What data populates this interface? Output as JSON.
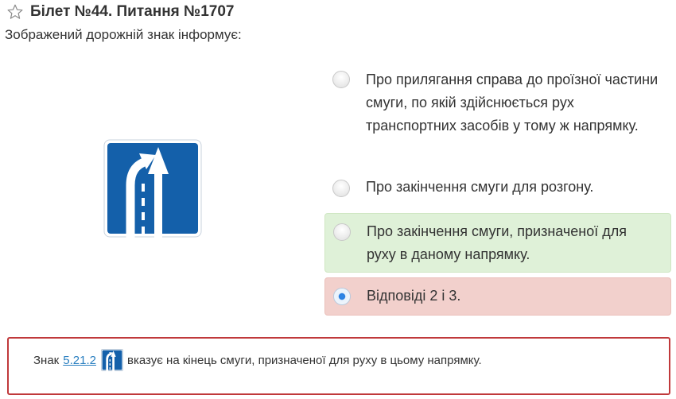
{
  "header": {
    "title": "Білет №44. Питання №1707",
    "star_icon": "star-outline-icon"
  },
  "question": {
    "text": "Зображений дорожній знак інформує:"
  },
  "sign": {
    "icon": "road-sign-5-21-2-icon",
    "colors": {
      "background": "#1460aa",
      "arrows": "#ffffff"
    }
  },
  "answers": [
    {
      "label": "Про прилягання справа до проїзної частини смуги, по якій здійснюється рух транспортних засобів у тому ж напрямку.",
      "selected": false,
      "state": ""
    },
    {
      "label": "Про закінчення смуги для розгону.",
      "selected": false,
      "state": ""
    },
    {
      "label": "Про закінчення смуги, призначеної для руху в даному напрямку.",
      "selected": false,
      "state": "correct"
    },
    {
      "label": "Відповіді 2 і 3.",
      "selected": true,
      "state": "wrong"
    }
  ],
  "explanation": {
    "prefix": "Знак",
    "link": "5.21.2",
    "suffix": "вказує на кінець смуги, призначеної для руху в цьому напрямку.",
    "border_color": "#c0393b"
  },
  "colors": {
    "correct_bg": "#dff1d8",
    "wrong_bg": "#f2d0cc",
    "radio_checked": "#2a7fe0",
    "link": "#2a7fc0"
  }
}
